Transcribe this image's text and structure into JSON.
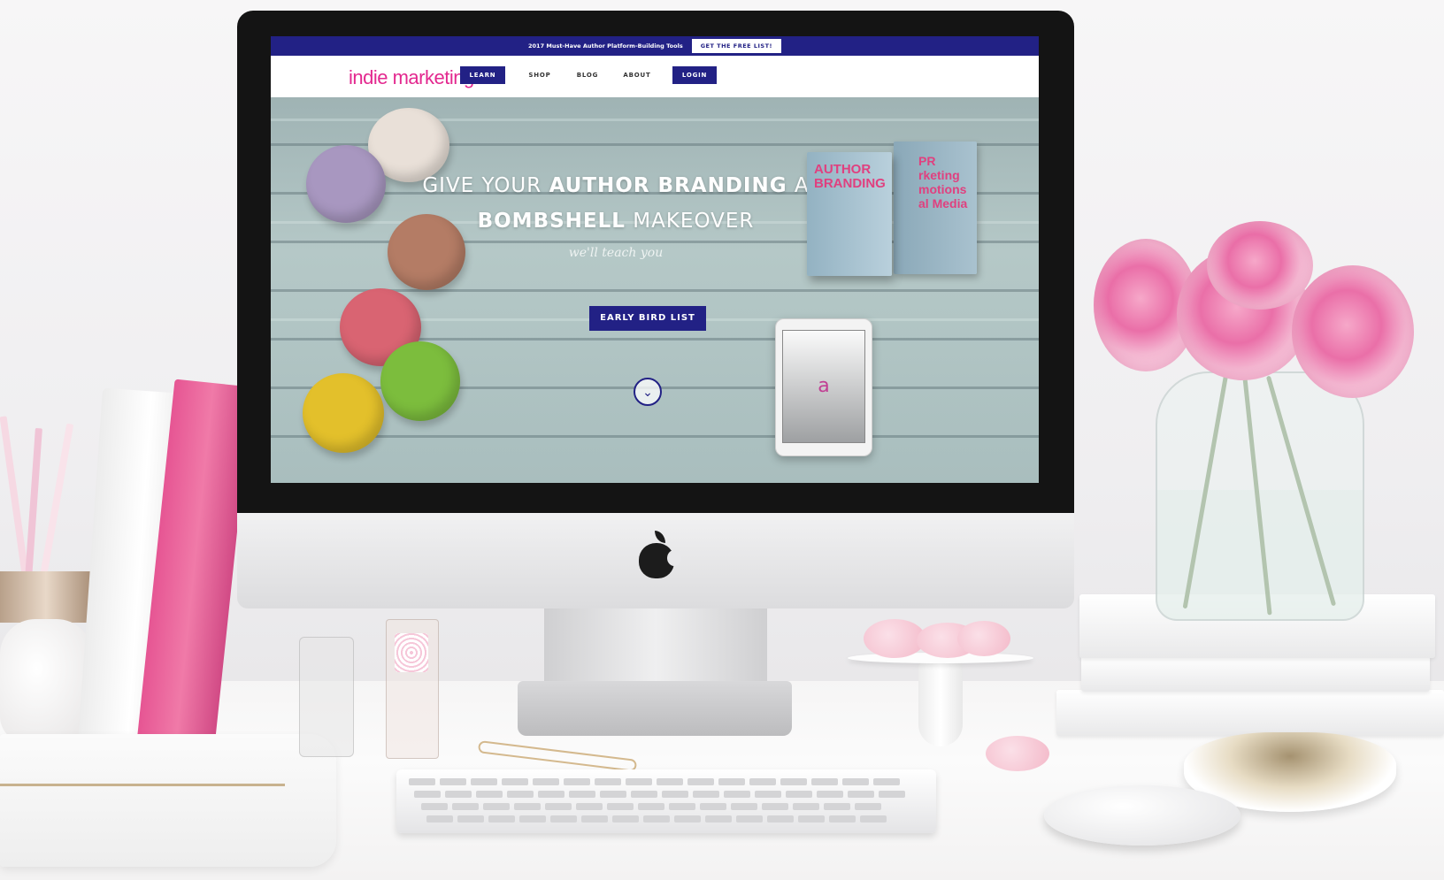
{
  "site": {
    "announcement": {
      "text": "2017 Must-Have Author Platform-Building Tools",
      "button_label": "GET THE FREE LIST!"
    },
    "logo": "indie marketing",
    "nav": [
      {
        "label": "LEARN",
        "style": "filled"
      },
      {
        "label": "SHOP",
        "style": "plain"
      },
      {
        "label": "BLOG",
        "style": "plain"
      },
      {
        "label": "ABOUT",
        "style": "plain"
      },
      {
        "label": "LOGIN",
        "style": "filled"
      }
    ],
    "hero": {
      "headline_pre": "GIVE YOUR ",
      "headline_bold1": "AUTHOR BRANDING",
      "headline_mid": " A",
      "headline_bold2": "BOMBSHELL",
      "headline_post": " MAKEOVER",
      "script_text": "we'll teach you",
      "cta_label": "EARLY BIRD LIST",
      "scroll_icon": "chevron-down-icon",
      "book_front_title": "AUTHOR BRANDING",
      "book_back_title": "PR rketing motions al Media",
      "tablet_mark": "a"
    }
  },
  "colors": {
    "brand_navy": "#222185",
    "brand_pink": "#e3288f"
  },
  "icons": {
    "apple_logo": "apple-logo-icon",
    "scroll_down": "chevron-down-icon"
  }
}
